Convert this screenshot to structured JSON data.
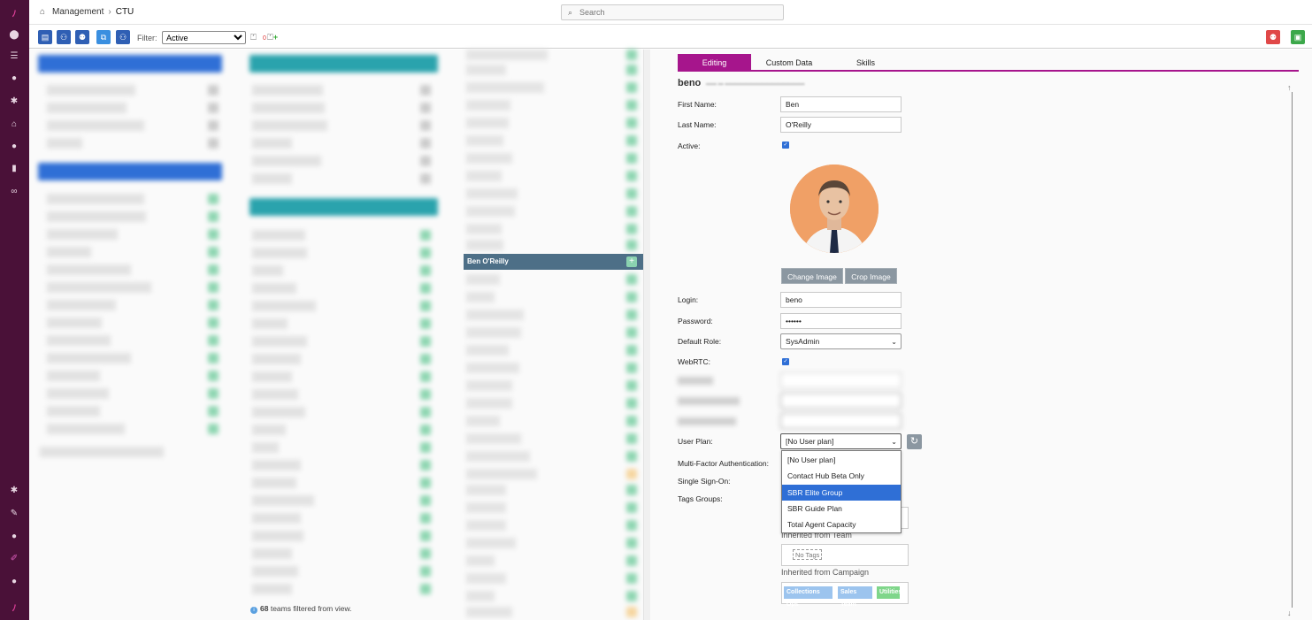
{
  "breadcrumb": {
    "root": "Management",
    "current": "CTU"
  },
  "search": {
    "placeholder": "Search"
  },
  "toolbar": {
    "filter_label": "Filter:",
    "filter_value": "Active",
    "tag_count": "0"
  },
  "colors": {
    "accent": "#a6158c",
    "sidebar": "#4a1138",
    "selection": "#4d6f87",
    "dropdown_selected": "#2f6fd6"
  },
  "teams_column": {
    "selected_member": "Ben O'Reilly"
  },
  "footnote": {
    "count": "68",
    "text": " teams filtered from view."
  },
  "editor": {
    "tabs": [
      {
        "label": "Editing"
      },
      {
        "label": "Custom Data"
      },
      {
        "label": "Skills"
      }
    ],
    "username": "beno",
    "labels": {
      "first_name": "First Name:",
      "last_name": "Last Name:",
      "active": "Active:",
      "login": "Login:",
      "password": "Password:",
      "default_role": "Default Role:",
      "webrtc": "WebRTC:",
      "user_plan": "User Plan:",
      "mfa": "Multi-Factor Authentication:",
      "sso": "Single Sign-On:",
      "tags_groups": "Tags Groups:"
    },
    "values": {
      "first_name": "Ben",
      "last_name": "O'Reilly",
      "login": "beno",
      "password": "••••••",
      "default_role": "SysAdmin",
      "user_plan": "[No User plan]"
    },
    "buttons": {
      "change_image": "Change Image",
      "crop_image": "Crop Image"
    },
    "user_plan_options": [
      {
        "label": "[No User plan]"
      },
      {
        "label": "Contact Hub Beta Only"
      },
      {
        "label": "SBR Elite Group"
      },
      {
        "label": "SBR Guide Plan"
      },
      {
        "label": "Total Agent Capacity"
      }
    ],
    "inherited": {
      "from_team": "Inherited from Team",
      "no_tags": "No Tags",
      "from_campaign": "Inherited from Campaign",
      "campaign_tags": [
        {
          "label": "Collections Ops"
        },
        {
          "label": "Sales Team"
        },
        {
          "label": "Utilities"
        }
      ]
    }
  }
}
